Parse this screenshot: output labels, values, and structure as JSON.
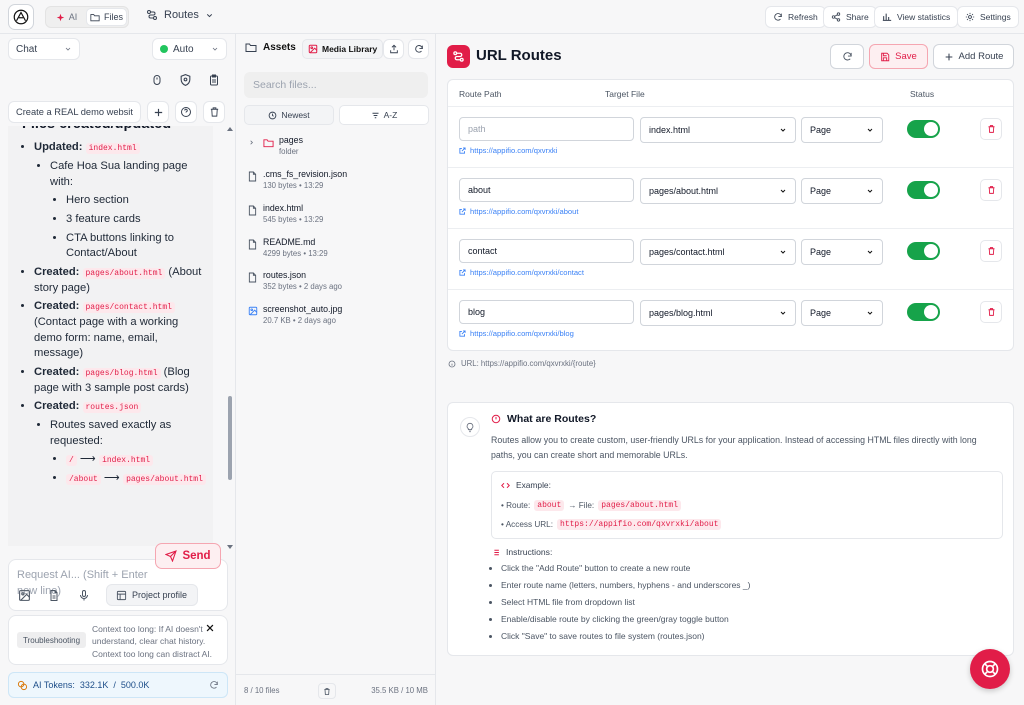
{
  "colors": {
    "accent": "#e11d48",
    "toggle_on": "#16a34a",
    "link": "#3b82f6"
  },
  "topbar": {
    "logo_icon": "openai-logo-icon",
    "tabs": [
      {
        "label": "AI",
        "icon": "sparkle-icon"
      },
      {
        "label": "Files",
        "icon": "folder-icon",
        "active": true
      }
    ],
    "routes_menu": "Routes",
    "actions": [
      {
        "label": "Refresh",
        "icon": "refresh-icon"
      },
      {
        "label": "Share",
        "icon": "share-icon"
      },
      {
        "label": "View statistics",
        "icon": "bar-chart-icon"
      },
      {
        "label": "Settings",
        "icon": "gear-icon"
      }
    ]
  },
  "chat": {
    "mode_select": "Chat",
    "model_select": "Auto",
    "session_select": "Create a REAL demo websit",
    "message": {
      "heading": "Files created/updated",
      "updated_label": "Updated:",
      "updated_file": "index.html",
      "updated_desc": "Cafe Hoa Sua landing page with:",
      "features": [
        "Hero section",
        "3 feature cards",
        "CTA buttons linking to Contact/About"
      ],
      "created": [
        {
          "label": "Created:",
          "file": "pages/about.html",
          "desc": "(About story page)"
        },
        {
          "label": "Created:",
          "file": "pages/contact.html",
          "desc": "(Contact page with a working demo form: name, email, message)"
        },
        {
          "label": "Created:",
          "file": "pages/blog.html",
          "desc": "(Blog page with 3 sample post cards)"
        },
        {
          "label": "Created:",
          "file": "routes.json",
          "desc": ""
        }
      ],
      "routes_saved": "Routes saved exactly as requested:",
      "route_map": [
        {
          "route": "/",
          "arrow": "⟶",
          "file": "index.html"
        },
        {
          "route": "/about",
          "arrow": "⟶",
          "file": "pages/about.html"
        }
      ]
    },
    "composer_placeholder": "Request AI... (Shift + Enter new line)",
    "send_label": "Send",
    "project_profile": "Project profile",
    "troubleshooting_label": "Troubleshooting",
    "troubleshooting_text": "Context too long: If AI doesn't understand, clear chat history. Context too long can distract AI.",
    "tokens_label": "AI Tokens:",
    "tokens_used": "332.1K",
    "tokens_sep": "/",
    "tokens_total": "500.0K"
  },
  "assets": {
    "title": "Assets",
    "media_library": "Media Library",
    "search_placeholder": "Search files...",
    "sort_newest": "Newest",
    "sort_az": "A-Z",
    "folder": {
      "name": "pages",
      "meta": "folder"
    },
    "files": [
      {
        "name": ".cms_fs_revision.json",
        "meta": "130 bytes • 13:29",
        "icon": "file-icon"
      },
      {
        "name": "index.html",
        "meta": "545 bytes • 13:29",
        "icon": "file-icon"
      },
      {
        "name": "README.md",
        "meta": "4299 bytes • 13:29",
        "icon": "file-icon"
      },
      {
        "name": "routes.json",
        "meta": "352 bytes • 2 days ago",
        "icon": "file-icon"
      },
      {
        "name": "screenshot_auto.jpg",
        "meta": "20.7 KB • 2 days ago",
        "icon": "image-icon"
      }
    ],
    "footer_count": "8 / 10 files",
    "footer_size": "35.5 KB / 10 MB"
  },
  "routes": {
    "title": "URL Routes",
    "save_label": "Save",
    "add_label": "Add Route",
    "columns": [
      "Route Path",
      "Target File",
      "Status"
    ],
    "rows": [
      {
        "path": "",
        "placeholder": "path",
        "file": "index.html",
        "type": "Page",
        "url": "https://appifio.com/qxvrxki",
        "enabled": true
      },
      {
        "path": "about",
        "placeholder": "path",
        "file": "pages/about.html",
        "type": "Page",
        "url": "https://appifio.com/qxvrxki/about",
        "enabled": true
      },
      {
        "path": "contact",
        "placeholder": "path",
        "file": "pages/contact.html",
        "type": "Page",
        "url": "https://appifio.com/qxvrxki/contact",
        "enabled": true
      },
      {
        "path": "blog",
        "placeholder": "path",
        "file": "pages/blog.html",
        "type": "Page",
        "url": "https://appifio.com/qxvrxki/blog",
        "enabled": true
      }
    ],
    "url_hint": "URL: https://appifio.com/qxvrxki/{route}"
  },
  "info": {
    "title": "What are Routes?",
    "desc": "Routes allow you to create custom, user-friendly URLs for your application. Instead of accessing HTML files directly with long paths, you can create short and memorable URLs.",
    "example_label": "Example:",
    "route_prefix": "• Route:",
    "route_val": "about",
    "file_prefix": "→ File:",
    "file_val": "pages/about.html",
    "access_prefix": "• Access URL:",
    "access_val": "https://appifio.com/qxvrxki/about",
    "instructions_label": "Instructions:",
    "instructions": [
      "Click the \"Add Route\" button to create a new route",
      "Enter route name (letters, numbers, hyphens - and underscores _)",
      "Select HTML file from dropdown list",
      "Enable/disable route by clicking the green/gray toggle button",
      "Click \"Save\" to save routes to file system (routes.json)"
    ]
  }
}
